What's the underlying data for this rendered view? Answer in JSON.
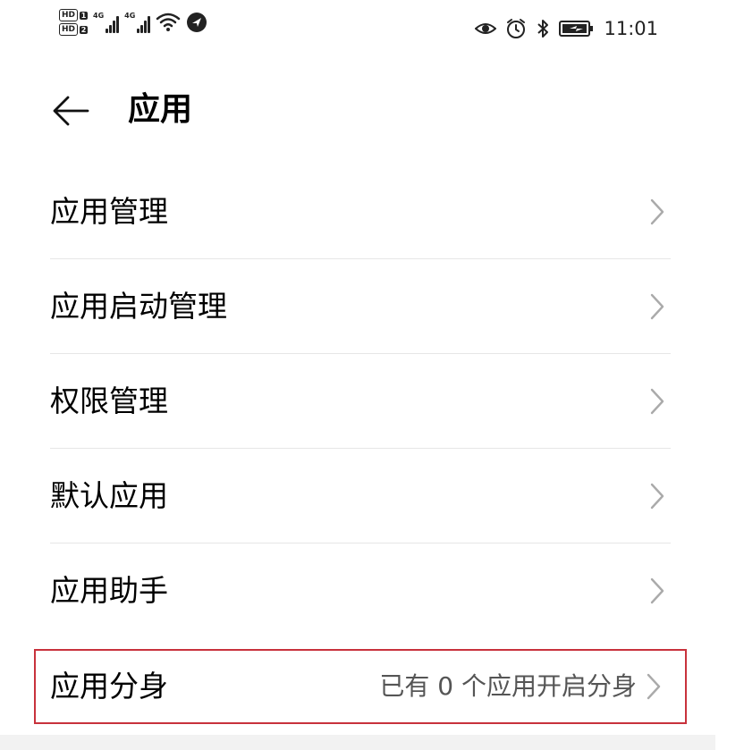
{
  "status_bar": {
    "hd1": "HD",
    "hd1_num": "1",
    "hd2": "HD",
    "hd2_num": "2",
    "sim1_net": "4G",
    "sim2_net": "4G",
    "time": "11:01",
    "icons": [
      "hd-icon",
      "signal-icon",
      "wifi-icon",
      "location-icon",
      "eye-icon",
      "alarm-icon",
      "bluetooth-icon",
      "battery-icon"
    ]
  },
  "header": {
    "title": "应用"
  },
  "menu": {
    "items": [
      {
        "label": "应用管理",
        "value": ""
      },
      {
        "label": "应用启动管理",
        "value": ""
      },
      {
        "label": "权限管理",
        "value": ""
      },
      {
        "label": "默认应用",
        "value": ""
      },
      {
        "label": "应用助手",
        "value": ""
      },
      {
        "label": "应用分身",
        "value": "已有 0 个应用开启分身"
      }
    ]
  },
  "colors": {
    "highlight_border": "#c8323c",
    "divider": "#e6e6e6",
    "secondary_text": "#555555"
  }
}
